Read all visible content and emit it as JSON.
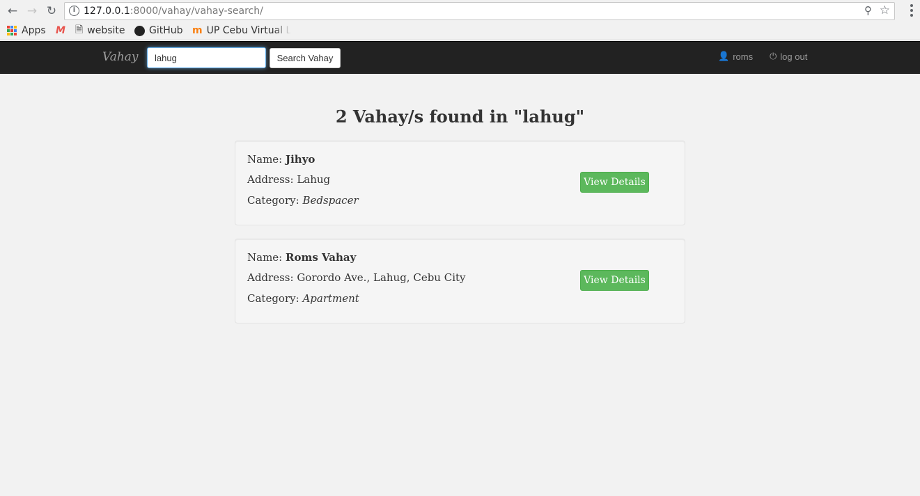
{
  "browser": {
    "url_host": "127.0.0.1",
    "url_path": ":8000/vahay/vahay-search/",
    "bookmarks": [
      "Apps",
      "website",
      "GitHub",
      "UP Cebu Virtual L"
    ]
  },
  "navbar": {
    "brand": "Vahay",
    "search_value": "lahug",
    "search_button": "Search Vahay",
    "user": "roms",
    "logout": "log out"
  },
  "results": {
    "heading": "2 Vahay/s found in \"lahug\"",
    "name_label": "Name: ",
    "address_label": "Address: ",
    "category_label": "Category: ",
    "button_label": "View Details",
    "items": [
      {
        "name": "Jihyo",
        "address": "Lahug",
        "category": "Bedspacer"
      },
      {
        "name": "Roms Vahay",
        "address": "Gorordo Ave., Lahug, Cebu City",
        "category": "Apartment"
      }
    ]
  },
  "colors": {
    "navbar_bg": "#222222",
    "page_bg": "#f2f2f2",
    "success_button": "#5cb85c"
  }
}
